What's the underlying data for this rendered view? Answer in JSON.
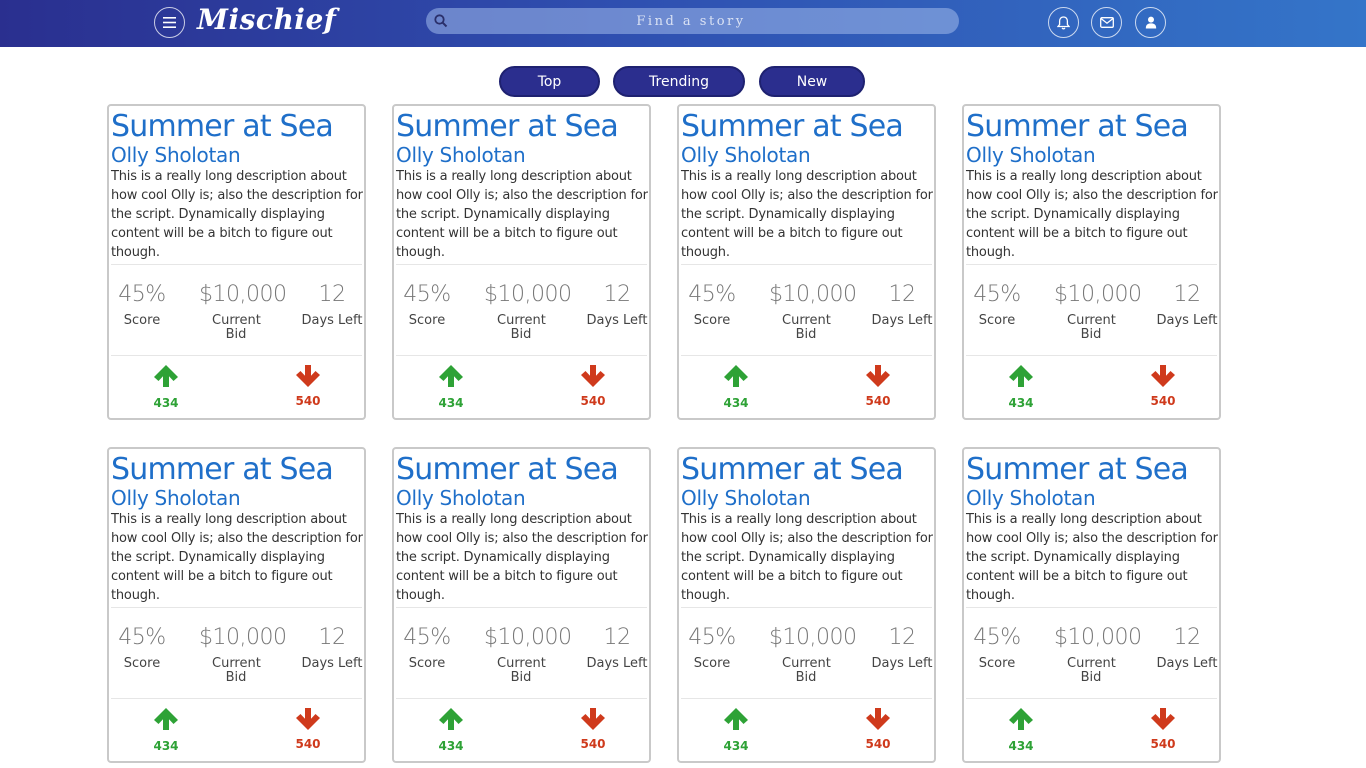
{
  "app": {
    "logo": "Mischief",
    "search_placeholder": "Find a story"
  },
  "colors": {
    "header_start": "#2a2f8f",
    "header_end": "#3475c9",
    "tab_bg": "#2b2e8e",
    "title": "#1f6fc9",
    "upvote": "#2ea236",
    "downvote": "#cf3a1c"
  },
  "icons": {
    "menu": "menu-icon",
    "search": "search-icon",
    "notifications": "bell-icon",
    "messages": "envelope-icon",
    "profile": "user-icon"
  },
  "tabs": [
    {
      "label": "Top"
    },
    {
      "label": "Trending"
    },
    {
      "label": "New"
    }
  ],
  "stories": [
    {
      "title": "Summer at Sea",
      "author": "Olly Sholotan",
      "description": "This is a really long description about how cool Olly is; also the description for the script. Dynamically displaying content will be a bitch to figure out though.",
      "score": "45%",
      "score_label": "Score",
      "bid": "$10,000",
      "bid_label": "Current Bid",
      "days": "12",
      "days_label": "Days Left",
      "upvotes": "434",
      "downvotes": "540"
    },
    {
      "title": "Summer at Sea",
      "author": "Olly Sholotan",
      "description": "This is a really long description about how cool Olly is; also the description for the script. Dynamically displaying content will be a bitch to figure out though.",
      "score": "45%",
      "score_label": "Score",
      "bid": "$10,000",
      "bid_label": "Current Bid",
      "days": "12",
      "days_label": "Days Left",
      "upvotes": "434",
      "downvotes": "540"
    },
    {
      "title": "Summer at Sea",
      "author": "Olly Sholotan",
      "description": "This is a really long description about how cool Olly is; also the description for the script. Dynamically displaying content will be a bitch to figure out though.",
      "score": "45%",
      "score_label": "Score",
      "bid": "$10,000",
      "bid_label": "Current Bid",
      "days": "12",
      "days_label": "Days Left",
      "upvotes": "434",
      "downvotes": "540"
    },
    {
      "title": "Summer at Sea",
      "author": "Olly Sholotan",
      "description": "This is a really long description about how cool Olly is; also the description for the script. Dynamically displaying content will be a bitch to figure out though.",
      "score": "45%",
      "score_label": "Score",
      "bid": "$10,000",
      "bid_label": "Current Bid",
      "days": "12",
      "days_label": "Days Left",
      "upvotes": "434",
      "downvotes": "540"
    },
    {
      "title": "Summer at Sea",
      "author": "Olly Sholotan",
      "description": "This is a really long description about how cool Olly is; also the description for the script. Dynamically displaying content will be a bitch to figure out though.",
      "score": "45%",
      "score_label": "Score",
      "bid": "$10,000",
      "bid_label": "Current Bid",
      "days": "12",
      "days_label": "Days Left",
      "upvotes": "434",
      "downvotes": "540"
    },
    {
      "title": "Summer at Sea",
      "author": "Olly Sholotan",
      "description": "This is a really long description about how cool Olly is; also the description for the script. Dynamically displaying content will be a bitch to figure out though.",
      "score": "45%",
      "score_label": "Score",
      "bid": "$10,000",
      "bid_label": "Current Bid",
      "days": "12",
      "days_label": "Days Left",
      "upvotes": "434",
      "downvotes": "540"
    },
    {
      "title": "Summer at Sea",
      "author": "Olly Sholotan",
      "description": "This is a really long description about how cool Olly is; also the description for the script. Dynamically displaying content will be a bitch to figure out though.",
      "score": "45%",
      "score_label": "Score",
      "bid": "$10,000",
      "bid_label": "Current Bid",
      "days": "12",
      "days_label": "Days Left",
      "upvotes": "434",
      "downvotes": "540"
    },
    {
      "title": "Summer at Sea",
      "author": "Olly Sholotan",
      "description": "This is a really long description about how cool Olly is; also the description for the script. Dynamically displaying content will be a bitch to figure out though.",
      "score": "45%",
      "score_label": "Score",
      "bid": "$10,000",
      "bid_label": "Current Bid",
      "days": "12",
      "days_label": "Days Left",
      "upvotes": "434",
      "downvotes": "540"
    }
  ]
}
